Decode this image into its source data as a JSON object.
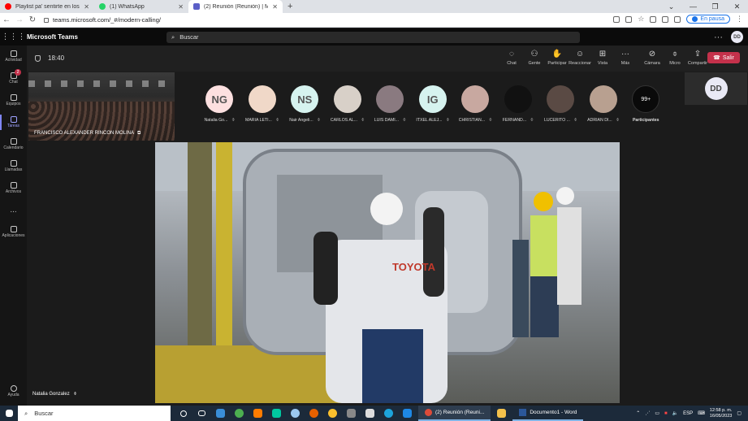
{
  "browser": {
    "tabs": [
      {
        "title": "Playlist pa' sentirte en los 80s (1...",
        "favicon_color": "#ff0000",
        "active": false
      },
      {
        "title": "(1) WhatsApp",
        "favicon_color": "#25d366",
        "active": false
      },
      {
        "title": "(2) Reunión (Reunión) | Micr...",
        "favicon_color": "#5b5fc7",
        "active": true
      }
    ],
    "url": "teams.microsoft.com/_#/modern-calling/",
    "pause_label": "En pausa"
  },
  "teams": {
    "brand": "Microsoft Teams",
    "search_placeholder": "Buscar",
    "user_initials": "DD",
    "rail": [
      {
        "label": "Actividad"
      },
      {
        "label": "Chat",
        "badge": "2"
      },
      {
        "label": "Equipos"
      },
      {
        "label": "Tareas",
        "active": true
      },
      {
        "label": "Calendario"
      },
      {
        "label": "Llamadas"
      },
      {
        "label": "Archivos"
      },
      {
        "label": "..."
      },
      {
        "label": "Aplicaciones"
      }
    ],
    "help_label": "Ayuda"
  },
  "meeting": {
    "timer": "18:40",
    "controls": [
      {
        "label": "Chat",
        "icon": "chat-icon"
      },
      {
        "label": "Gente",
        "icon": "people-icon"
      },
      {
        "label": "Participar",
        "icon": "hand-icon"
      },
      {
        "label": "Reaccionar",
        "icon": "smile-icon"
      },
      {
        "label": "Vista",
        "icon": "grid-icon"
      },
      {
        "label": "Más",
        "icon": "more-icon"
      },
      {
        "label": "Cámara",
        "icon": "camera-off-icon"
      },
      {
        "label": "Micro",
        "icon": "mic-off-icon"
      },
      {
        "label": "Compartir",
        "icon": "share-icon"
      }
    ],
    "leave_label": "Salir",
    "thumbnail_name": "FRANCISCO ALEXANDER RINCON MOLINA",
    "participants": [
      {
        "initials": "NG",
        "name": "Natalia Go...",
        "bg": "#fde0e0",
        "fg": "#555"
      },
      {
        "initials": "",
        "name": "MARIA LETI...",
        "bg": "#f0d8c8",
        "fg": "#555"
      },
      {
        "initials": "NS",
        "name": "Nair Angeli...",
        "bg": "#d6f3ef",
        "fg": "#555"
      },
      {
        "initials": "",
        "name": "CARLOS AL...",
        "bg": "#d8d0c8",
        "fg": "#555"
      },
      {
        "initials": "",
        "name": "LUIS DAMI...",
        "bg": "#8a7a80",
        "fg": "#555"
      },
      {
        "initials": "IG",
        "name": "ITXEL ALEJ...",
        "bg": "#d6f3ef",
        "fg": "#555"
      },
      {
        "initials": "",
        "name": "CHRISTIAN...",
        "bg": "#c8a8a0",
        "fg": "#555"
      },
      {
        "initials": "",
        "name": "FERNAND...",
        "bg": "#111111",
        "fg": "#555"
      },
      {
        "initials": "",
        "name": "LUCERITO ...",
        "bg": "#5a4a44",
        "fg": "#555"
      },
      {
        "initials": "",
        "name": "ADRIAN DI...",
        "bg": "#b8a090",
        "fg": "#555"
      }
    ],
    "more_count": "99+",
    "more_label": "Participantes",
    "self_initials": "DD",
    "speaker_name": "Natalia Gonzalez"
  },
  "taskbar": {
    "search_placeholder": "Buscar",
    "windows": [
      {
        "label": "(2) Reunión (Reuni...",
        "icon_color": "#dd4b39"
      },
      {
        "label": "Documento1 - Word",
        "icon_color": "#2b579a"
      }
    ],
    "lang": "ESP",
    "time": "12:58 p. m.",
    "date": "16/05/2023"
  }
}
